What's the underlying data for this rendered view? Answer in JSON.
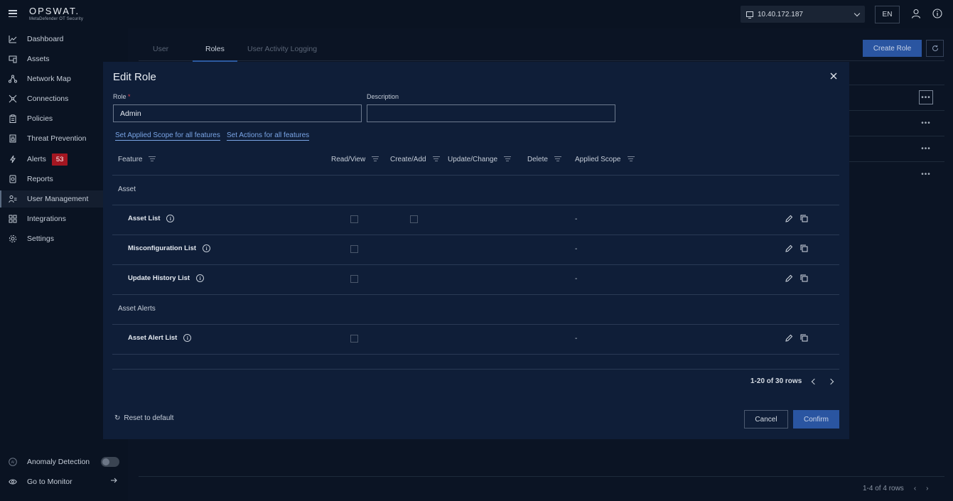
{
  "app": {
    "logo_main": "OPSWAT.",
    "logo_sub": "MetaDefender OT Security"
  },
  "topbar": {
    "device_ip": "10.40.172.187",
    "language": "EN"
  },
  "sidebar": {
    "items": [
      {
        "label": "Dashboard",
        "icon": "chart-line-icon"
      },
      {
        "label": "Assets",
        "icon": "devices-icon"
      },
      {
        "label": "Network Map",
        "icon": "network-icon"
      },
      {
        "label": "Connections",
        "icon": "connections-icon"
      },
      {
        "label": "Policies",
        "icon": "clipboard-icon"
      },
      {
        "label": "Threat Prevention",
        "icon": "document-shield-icon"
      },
      {
        "label": "Alerts",
        "icon": "bolt-icon",
        "badge": "53"
      },
      {
        "label": "Reports",
        "icon": "report-icon"
      },
      {
        "label": "User Management",
        "icon": "users-icon",
        "active": true
      },
      {
        "label": "Integrations",
        "icon": "integrations-icon"
      },
      {
        "label": "Settings",
        "icon": "gear-icon"
      }
    ],
    "anomaly_detection": "Anomaly Detection",
    "go_to_monitor": "Go to Monitor",
    "anomaly_enabled": false
  },
  "background": {
    "tabs": [
      "User",
      "Roles",
      "User Activity Logging"
    ],
    "active_tab": "Roles",
    "create_role": "Create Role",
    "pagination": "1-4 of 4 rows"
  },
  "modal": {
    "title": "Edit Role",
    "role_label": "Role",
    "role_required": "*",
    "role_value": "Admin",
    "description_label": "Description",
    "description_value": "",
    "link_scope": "Set Applied Scope for all features",
    "link_actions": "Set Actions for all features",
    "columns": [
      "Feature",
      "Read/View",
      "Create/Add",
      "Update/Change",
      "Delete",
      "Applied Scope"
    ],
    "groups": [
      {
        "name": "Asset",
        "features": [
          {
            "name": "Asset List",
            "read": false,
            "create": false,
            "scope": "-"
          },
          {
            "name": "Misconfiguration List",
            "read": false,
            "scope": "-"
          },
          {
            "name": "Update History List",
            "read": false,
            "scope": "-"
          }
        ]
      },
      {
        "name": "Asset Alerts",
        "features": [
          {
            "name": "Asset Alert List",
            "read": false,
            "scope": "-"
          }
        ]
      }
    ],
    "pagination": "1-20 of 30 rows",
    "reset": "Reset to default",
    "cancel": "Cancel",
    "confirm": "Confirm"
  },
  "colors": {
    "accent": "#2a55a1",
    "background": "#0b1424",
    "modal": "#0f1e38",
    "badge": "#a31621",
    "link": "#7aa5e6"
  }
}
